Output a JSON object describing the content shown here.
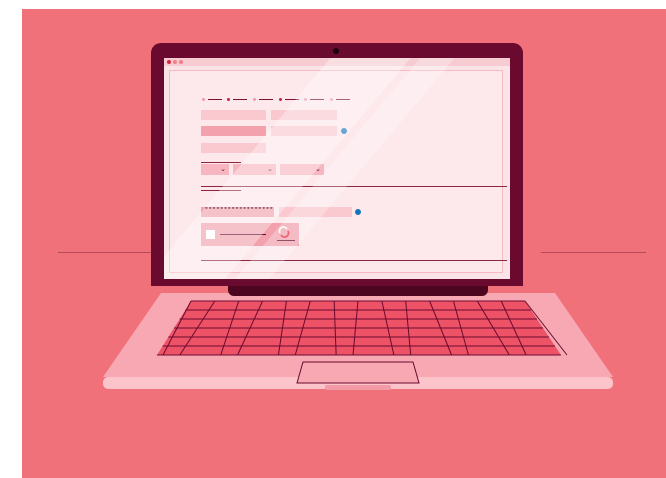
{
  "illustration": {
    "subject": "laptop-form-illustration",
    "colors": {
      "background": "#f1717b",
      "bezel": "#6a0a2e",
      "screen": "#fbe4e7",
      "deck": "#f7a8b3",
      "keys": "#ee5266",
      "accent_blue": "#1677b8"
    },
    "icons": [
      "window-dots-icon",
      "chevron-down-icon",
      "checkbox-icon",
      "captcha-refresh-icon",
      "camera-icon"
    ],
    "password_mask": "••••••••••••••••••••••"
  }
}
